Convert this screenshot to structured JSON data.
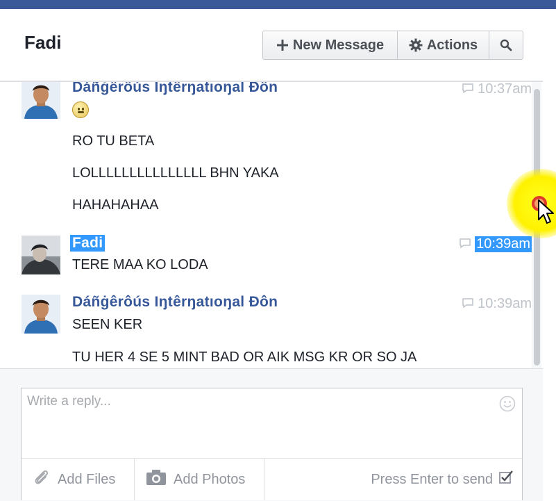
{
  "header": {
    "title": "Fadi",
    "new_message_label": "New Message",
    "actions_label": "Actions"
  },
  "icons": {
    "new_message": "plus-icon",
    "actions": "gear-icon",
    "search": "search-icon",
    "timestamp": "speech-bubble-icon",
    "emoji": "smiley-face-icon",
    "attach": "paperclip-icon",
    "photo": "camera-icon",
    "send_toggle": "checkbox-icon"
  },
  "thread": {
    "groups": [
      {
        "sender": "Dáñġêrôús Iŋtêrŋatıoŋal Ðôn",
        "time": "10:37am",
        "emoji": "slight-smile",
        "messages": [
          "RO TU BETA",
          "LOLLLLLLLLLLLLLLL BHN YAKA",
          "HAHAHAHAA"
        ]
      },
      {
        "sender": "Fadi",
        "time": "10:39am",
        "selected": true,
        "messages": [
          "TERE MAA KO LODA"
        ]
      },
      {
        "sender": "Dáñġêrôús Iŋtêrŋatıoŋal Ðôn",
        "time": "10:39am",
        "messages": [
          "SEEN KER",
          "TU HER 4 SE 5 MINT BAD OR AIK MSG KR OR SO JA"
        ]
      }
    ]
  },
  "composer": {
    "placeholder": "Write a reply...",
    "add_files_label": "Add Files",
    "add_photos_label": "Add Photos",
    "press_enter_label": "Press Enter to send",
    "press_enter_checked": true
  },
  "colors": {
    "topbar": "#3b5998",
    "sender_link": "#365899",
    "selection": "#3399ff",
    "cursor_highlight": "#fff200"
  }
}
